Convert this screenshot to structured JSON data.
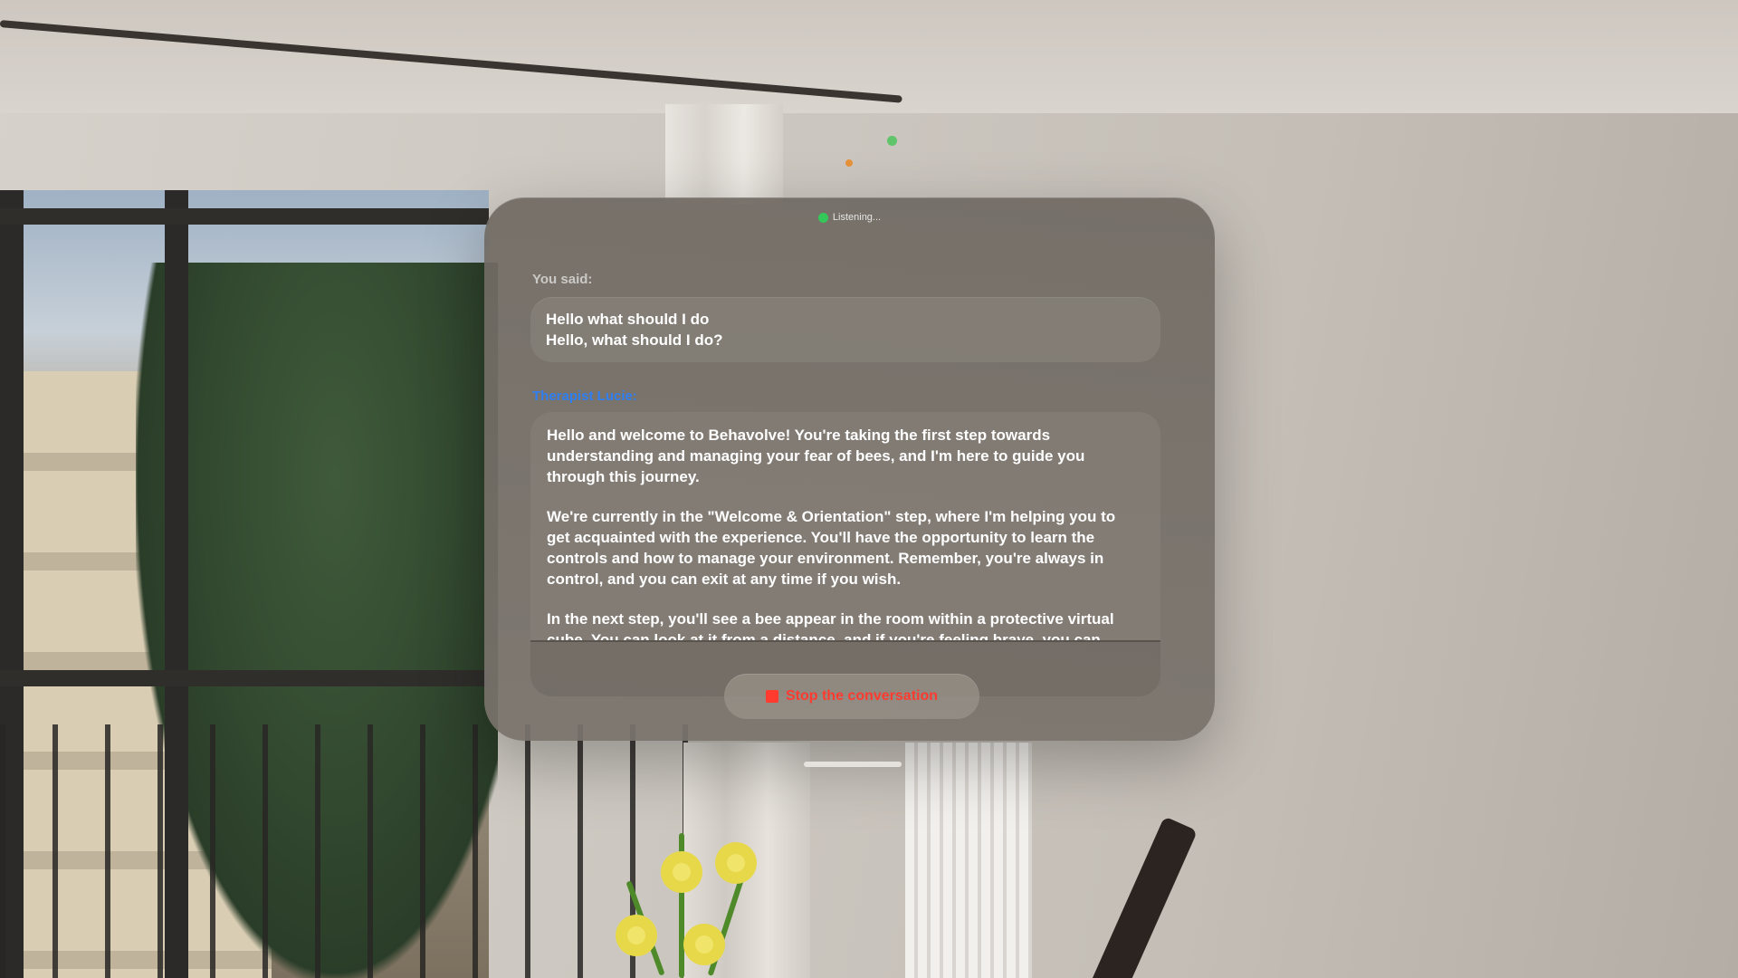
{
  "status": {
    "text": "Listening...",
    "indicator_color": "#34c759"
  },
  "conversation": {
    "user_label": "You said:",
    "user_lines": [
      "Hello what should I do",
      "Hello, what should I do?"
    ],
    "therapist_label": "Therapist Lucie:",
    "therapist_paragraphs": [
      "Hello and welcome to Behavolve! You're taking the first step towards understanding and managing your fear of bees, and I'm here to guide you through this journey.",
      "We're currently in the \"Welcome & Orientation\" step, where I'm helping you to get acquainted with the experience. You'll have the opportunity to learn the controls and how to manage your environment. Remember, you're always in control, and you can exit at any time if you wish.",
      "In the next step, you'll see a bee appear in the room within a protective virtual cube. You can look at it from a distance, and if you're feeling brave, you can"
    ]
  },
  "controls": {
    "stop_label": "Stop the conversation",
    "stop_color": "#ff3b30"
  },
  "colors": {
    "accent_therapist": "#2f7ff2",
    "panel": "#6f6a63"
  },
  "icons": [
    "status-dot-icon",
    "stop-square-icon",
    "window-grabber"
  ]
}
